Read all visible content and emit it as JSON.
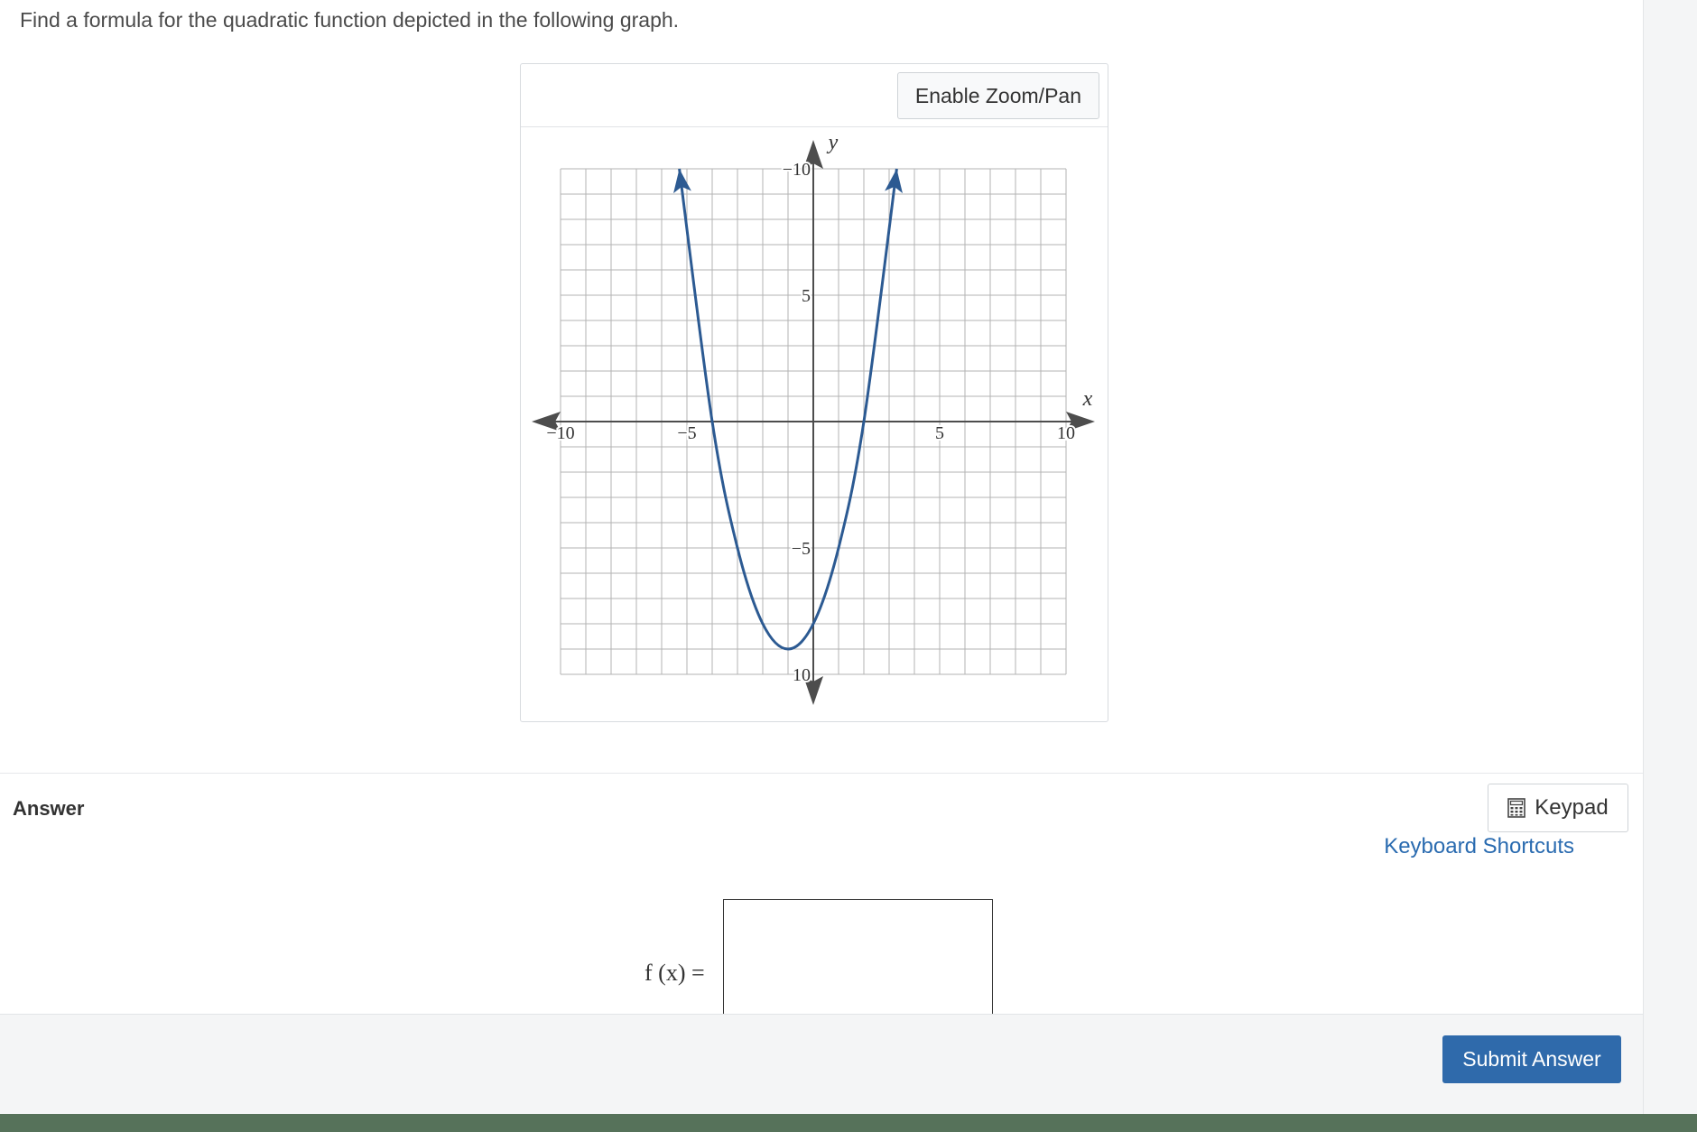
{
  "question": {
    "text": "Find a formula for the quadratic function depicted in the following graph."
  },
  "graph": {
    "zoom_button_label": "Enable Zoom/Pan",
    "x_axis_label": "x",
    "y_axis_label": "y",
    "x_tick_labels": [
      "−10",
      "−5",
      "5",
      "10"
    ],
    "y_tick_labels": [
      "10",
      "5",
      "−5",
      "−10"
    ],
    "colors": {
      "curve": "#2c5a92",
      "axis": "#4d4d4d",
      "grid": "#b3b3b3"
    }
  },
  "chart_data": {
    "type": "line",
    "title": "",
    "xlabel": "x",
    "ylabel": "y",
    "xlim": [
      -10,
      10
    ],
    "ylim": [
      -10,
      10
    ],
    "grid": true,
    "xticks": [
      -10,
      -5,
      5,
      10
    ],
    "yticks": [
      -10,
      5,
      -5,
      10
    ],
    "series": [
      {
        "points": [
          [
            -5.3,
            10
          ],
          [
            -4,
            0
          ],
          [
            -3,
            -5
          ],
          [
            -2,
            -8
          ],
          [
            -1,
            -9
          ],
          [
            0,
            -8
          ],
          [
            1,
            -5
          ],
          [
            2,
            0
          ],
          [
            3.3,
            10
          ]
        ]
      }
    ]
  },
  "answer": {
    "title": "Answer",
    "keypad_label": "Keypad",
    "keyboard_shortcuts_label": "Keyboard Shortcuts",
    "function_label": "f (x)  =",
    "input_value": ""
  },
  "footer": {
    "submit_label": "Submit Answer"
  }
}
